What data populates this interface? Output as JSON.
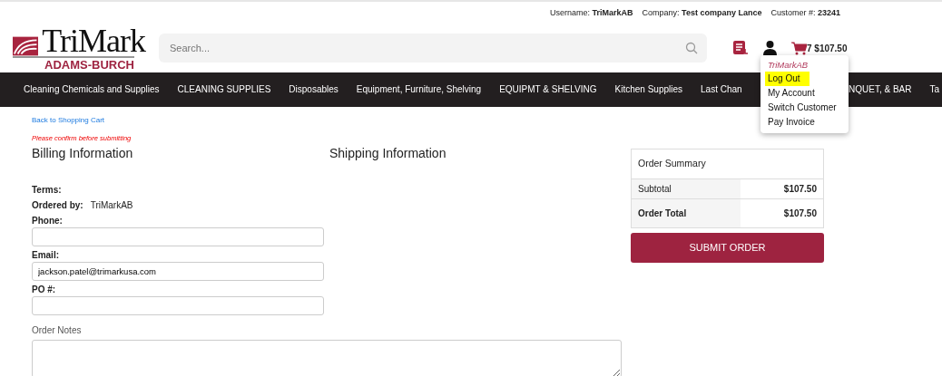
{
  "user_info": [
    {
      "label": "Username:",
      "value": "TriMarkAB"
    },
    {
      "label": "Company:",
      "value": "Test company Lance"
    },
    {
      "label": "Customer #:",
      "value": "23241"
    }
  ],
  "logo": {
    "name": "TriMark",
    "sub": "ADAMS-BURCH"
  },
  "search": {
    "placeholder": "Search..."
  },
  "cart": {
    "count": "7",
    "total": "$107.50"
  },
  "nav": [
    "Cleaning Chemicals and Supplies",
    "CLEANING SUPPLIES",
    "Disposables",
    "Equipment, Furniture, Shelving",
    "EQUIPMT & SHELVING",
    "Kitchen Supplies",
    "Last Chan",
    "NQUET, & BAR",
    "Ta"
  ],
  "account_menu": {
    "header": "TriMarkAB",
    "items": [
      {
        "label": "Log Out",
        "highlighted": true
      },
      {
        "label": "My Account",
        "highlighted": false
      },
      {
        "label": "Switch Customer",
        "highlighted": false
      },
      {
        "label": "Pay Invoice",
        "highlighted": false
      }
    ]
  },
  "back_link": "Back to Shopping Cart",
  "warning": "Please confirm before submitting",
  "billing": {
    "title": "Billing Information",
    "terms_label": "Terms:",
    "ordered_by_label": "Ordered by:",
    "ordered_by": "TriMarkAB",
    "fields": [
      {
        "label": "Phone:"
      },
      {
        "label": "Email:",
        "value": "jackson.patel@trimarkusa.com"
      },
      {
        "label": "PO #:"
      }
    ]
  },
  "shipping": {
    "title": "Shipping Information"
  },
  "notes_label": "Order Notes",
  "summary": {
    "title": "Order Summary",
    "rows": [
      {
        "label": "Subtotal",
        "value": "$107.50",
        "bold": false
      },
      {
        "label": "Order Total",
        "value": "$107.50",
        "bold": true
      }
    ]
  },
  "submit": "SUBMIT ORDER"
}
